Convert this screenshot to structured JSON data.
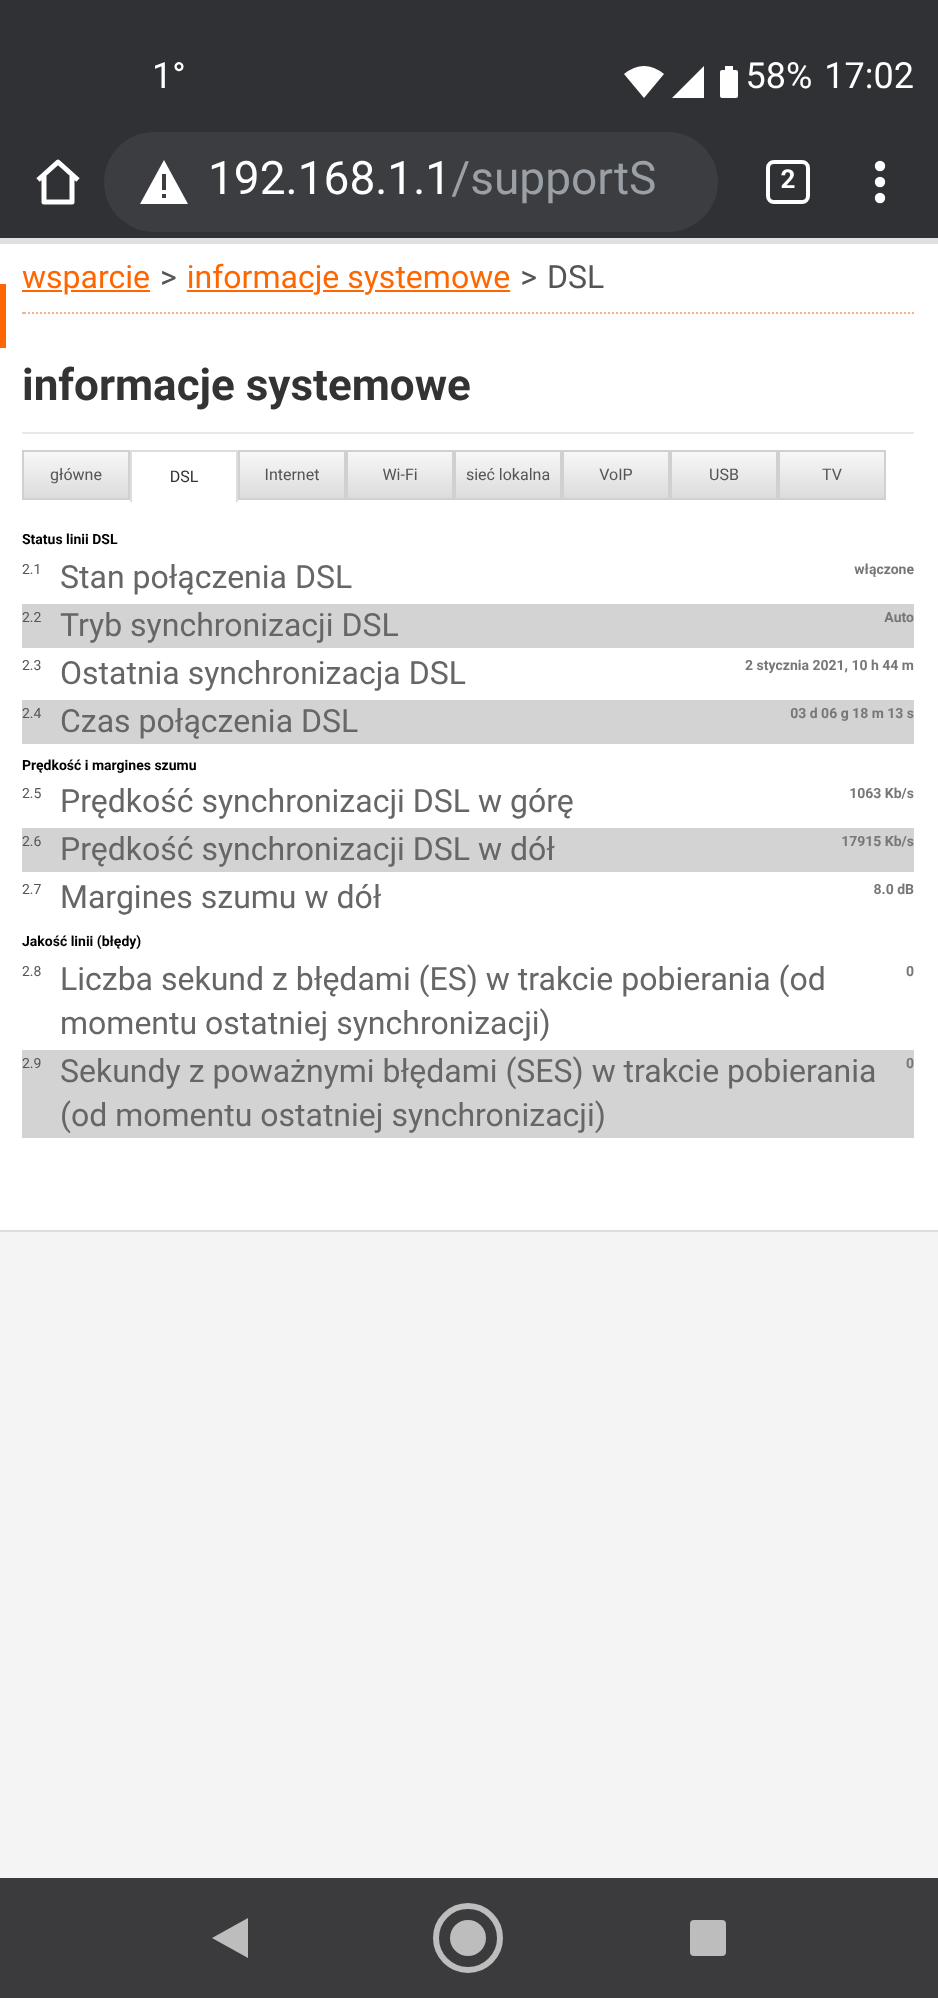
{
  "status_bar": {
    "temperature": "1°",
    "battery": "58%",
    "time": "17:02"
  },
  "browser": {
    "url_host": "192.168.1.1",
    "url_path": "/supportS",
    "tab_count": "2"
  },
  "breadcrumb": {
    "links": [
      "wsparcie",
      "informacje systemowe"
    ],
    "separators": [
      ">",
      ">"
    ],
    "current": "DSL"
  },
  "title": "informacje systemowe",
  "tabs": [
    {
      "label": "główne",
      "selected": false
    },
    {
      "label": "DSL",
      "selected": true
    },
    {
      "label": "Internet",
      "selected": false
    },
    {
      "label": "Wi-Fi",
      "selected": false
    },
    {
      "label": "sieć lokalna",
      "selected": false
    },
    {
      "label": "VoIP",
      "selected": false
    },
    {
      "label": "USB",
      "selected": false
    },
    {
      "label": "TV",
      "selected": false
    }
  ],
  "sections": [
    {
      "heading": "Status linii DSL",
      "rows": [
        {
          "number": "2.1",
          "label": "Stan połączenia DSL",
          "value": "włączone"
        },
        {
          "number": "2.2",
          "label": "Tryb synchronizacji DSL",
          "value": "Auto"
        },
        {
          "number": "2.3",
          "label": "Ostatnia synchronizacja DSL",
          "value": "2 stycznia 2021, 10 h 44 m"
        },
        {
          "number": "2.4",
          "label": "Czas połączenia DSL",
          "value": "03 d 06 g 18 m 13 s"
        }
      ]
    },
    {
      "heading": "Prędkość i margines szumu",
      "rows": [
        {
          "number": "2.5",
          "label": "Prędkość synchronizacji DSL w górę",
          "value": "1063 Kb/s"
        },
        {
          "number": "2.6",
          "label": "Prędkość synchronizacji DSL w dół",
          "value": "17915 Kb/s"
        },
        {
          "number": "2.7",
          "label": "Margines szumu w dół",
          "value": "8.0 dB"
        }
      ]
    },
    {
      "heading": "Jakość linii (błędy)",
      "rows": [
        {
          "number": "2.8",
          "label": "Liczba sekund z błędami (ES) w trakcie pobierania (od momentu ostatniej synchronizacji)",
          "value": "0"
        },
        {
          "number": "2.9",
          "label": "Sekundy z poważnymi błędami (SES) w trakcie pobierania (od momentu ostatniej synchronizacji)",
          "value": "0"
        }
      ]
    }
  ]
}
